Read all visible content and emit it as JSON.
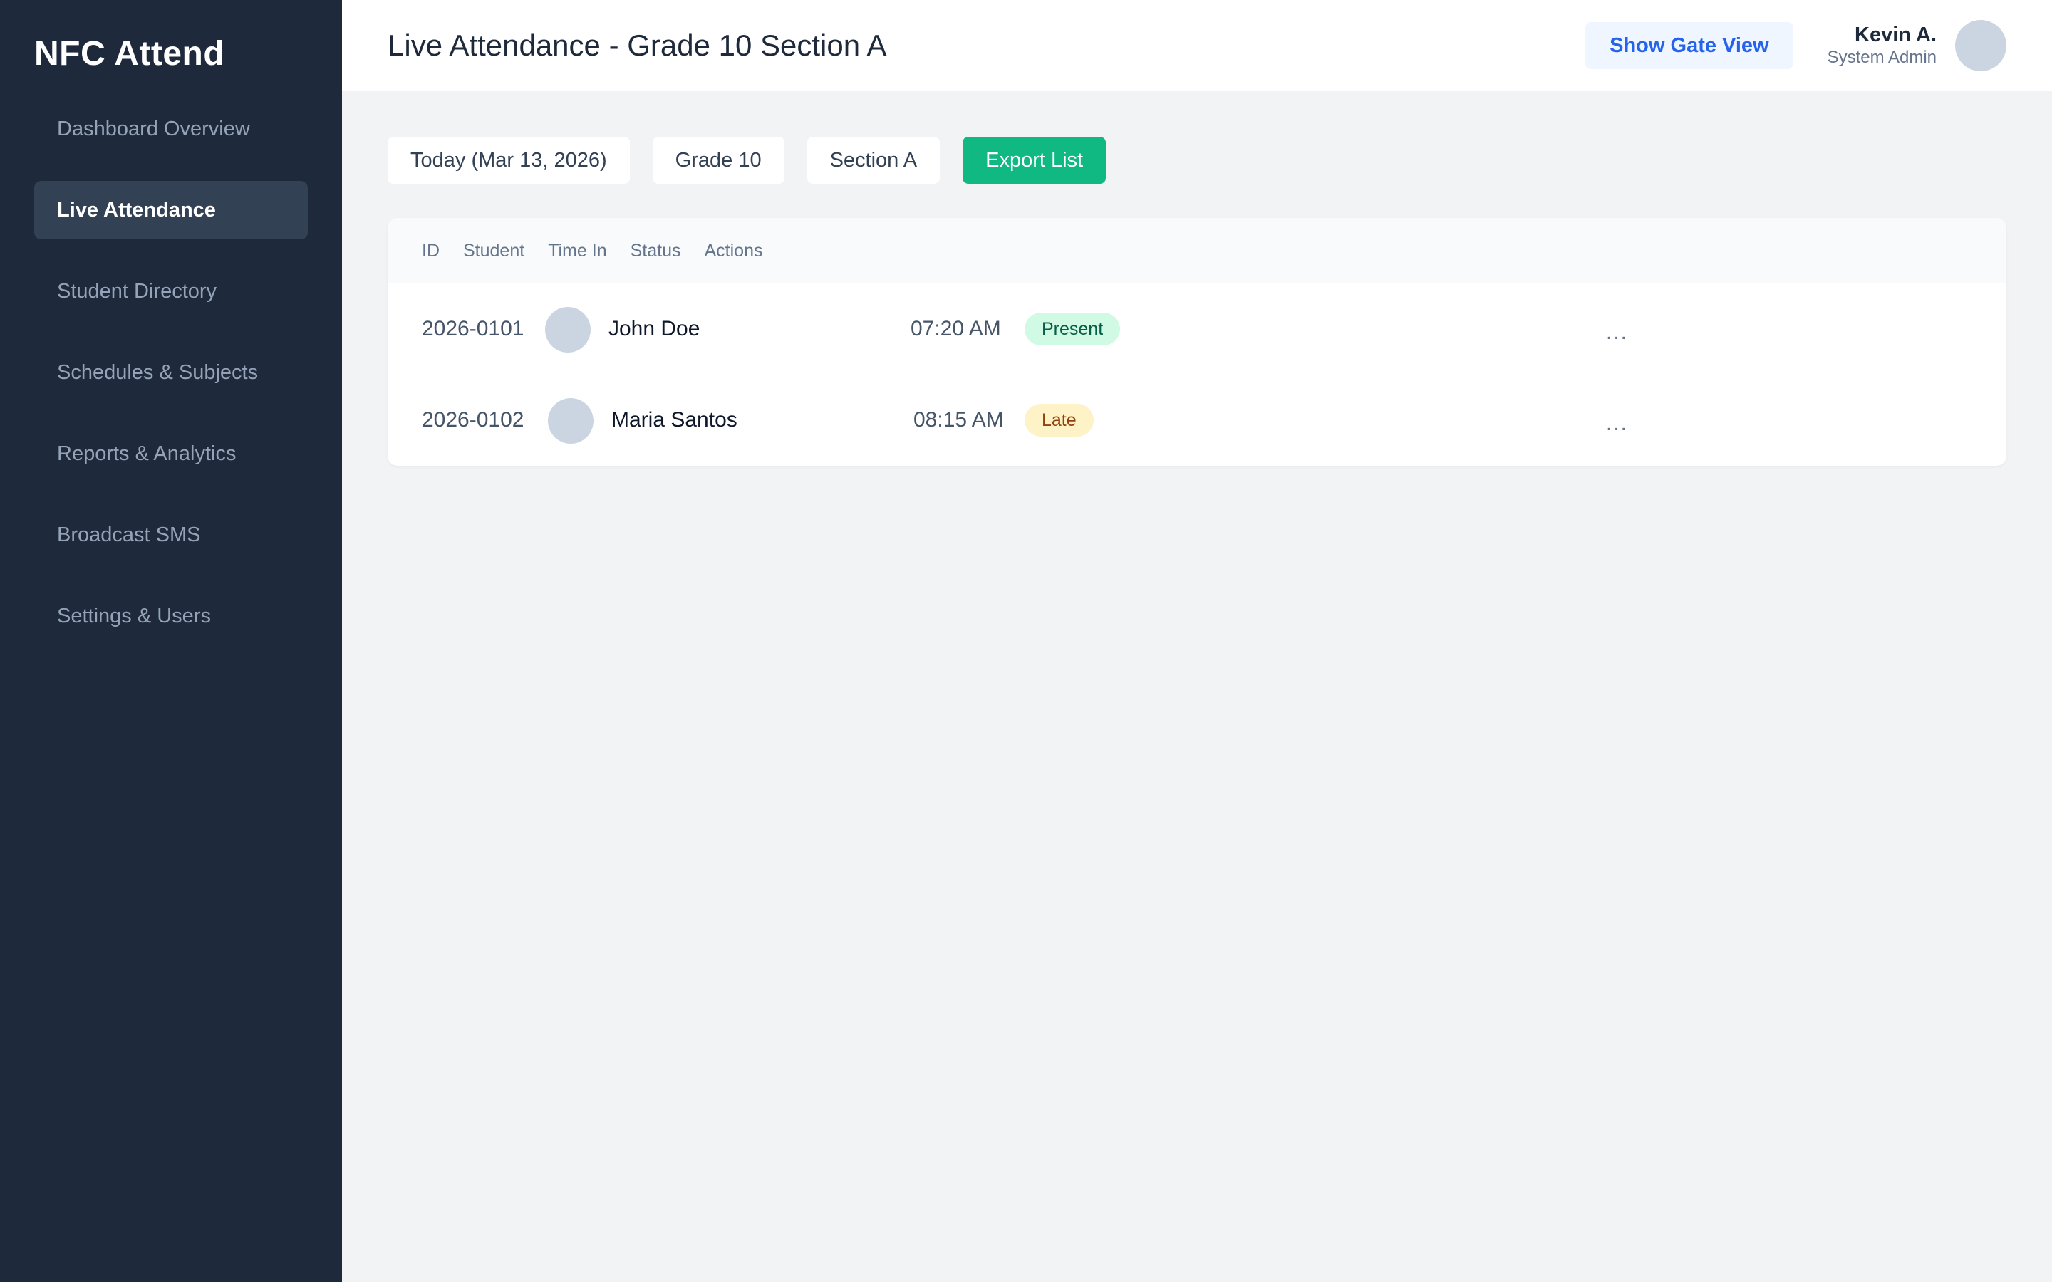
{
  "sidebar": {
    "brand": "NFC Attend",
    "items": [
      {
        "label": "Dashboard Overview"
      },
      {
        "label": "Live Attendance"
      },
      {
        "label": "Student Directory"
      },
      {
        "label": "Schedules & Subjects"
      },
      {
        "label": "Reports & Analytics"
      },
      {
        "label": "Broadcast SMS"
      },
      {
        "label": "Settings & Users"
      }
    ],
    "active": "Live Attendance"
  },
  "header": {
    "title": "Live Attendance - Grade 10 Section A",
    "gate_button": "Show Gate View",
    "user_name": "Kevin A.",
    "user_role": "System Admin"
  },
  "filters": {
    "date": "Today (Mar 13, 2026)",
    "grade": "Grade 10",
    "section": "Section A",
    "export": "Export List"
  },
  "table": {
    "columns": [
      "ID",
      "Student",
      "Time In",
      "Status",
      "Actions"
    ],
    "rows": [
      {
        "id": "2026-0101",
        "name": "John Doe",
        "time_in": "07:20 AM",
        "status": "Present",
        "actions": "..."
      },
      {
        "id": "2026-0102",
        "name": "Maria Santos",
        "time_in": "08:15 AM",
        "status": "Late",
        "actions": "..."
      }
    ]
  },
  "colors": {
    "sidebar_bg": "#1e293b",
    "accent_green": "#10b981",
    "accent_blue": "#2563eb"
  }
}
